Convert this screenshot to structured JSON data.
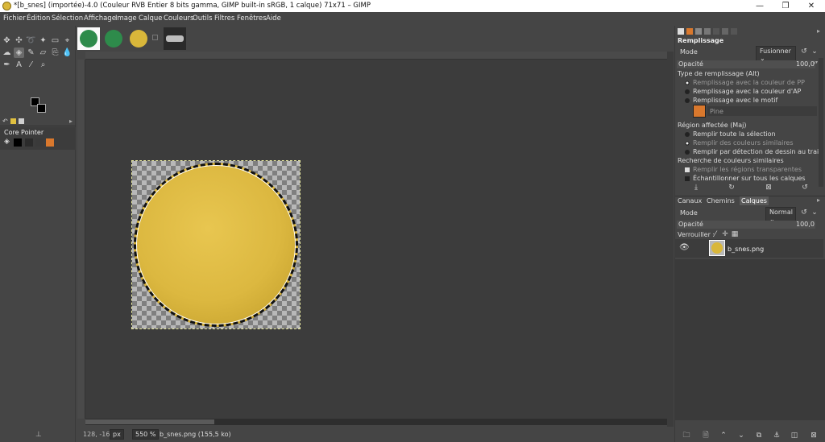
{
  "window": {
    "title": "*[b_snes] (importée)-4.0 (Couleur RVB Entier 8 bits gamma, GIMP built-in sRGB, 1 calque) 71x71 – GIMP",
    "minimize": "—",
    "maximize": "❐",
    "close": "✕"
  },
  "menu": [
    "Fichier",
    "Édition",
    "Sélection",
    "Affichage",
    "Image",
    "Calque",
    "Couleurs",
    "Outils",
    "Filtres",
    "Fenêtres",
    "Aide"
  ],
  "toolbox": {
    "device_panel_title": "Core Pointer",
    "device_swatch_colors": [
      "#000000",
      "#2b2b2b",
      "#3a3a3a",
      "#d9782d"
    ]
  },
  "image_tabs": [
    {
      "name": "green-button-1",
      "color": "#2e8b4b"
    },
    {
      "name": "green-button-2",
      "color": "#2e8b4b"
    },
    {
      "name": "yellow-button",
      "color": "#d9b73a"
    }
  ],
  "statusbar": {
    "coords": "128, -16",
    "unit": "px",
    "zoom": "550 %",
    "fileinfo": "b_snes.png (155,5 ko)"
  },
  "fill_options": {
    "title": "Remplissage",
    "mode_label": "Mode",
    "mode_value": "Fusionner",
    "opacity_label": "Opacité",
    "opacity_value": "100,0",
    "opacity_fraction": 1.0,
    "fill_type_label": "Type de remplissage  (Alt)",
    "fill_types": [
      {
        "label": "Remplissage avec la couleur de PP",
        "selected": true
      },
      {
        "label": "Remplissage avec la couleur d'AP",
        "selected": false
      },
      {
        "label": "Remplissage avec le motif",
        "selected": false
      }
    ],
    "pattern_name": "Pine",
    "region_label": "Région affectée  (Maj)",
    "regions": [
      {
        "label": "Remplir toute la sélection",
        "selected": false
      },
      {
        "label": "Remplir des couleurs similaires",
        "selected": true
      },
      {
        "label": "Remplir par détection de dessin au trait",
        "selected": false
      }
    ],
    "similar_label": "Recherche de couleurs similaires",
    "similar_options": [
      {
        "label": "Remplir les régions transparentes",
        "checked": true
      },
      {
        "label": "Échantillonner sur tous les calques",
        "checked": false
      }
    ]
  },
  "layers_panel": {
    "tabs": [
      "Canaux",
      "Chemins",
      "Calques"
    ],
    "mode_label": "Mode",
    "mode_value": "Normal",
    "opacity_label": "Opacité",
    "opacity_value": "100,0",
    "opacity_fraction": 1.0,
    "lock_label": "Verrouiller :",
    "layers": [
      {
        "name": "b_snes.png",
        "visible": true
      }
    ]
  },
  "colors": {
    "accent_orange": "#d9782d",
    "coin_yellow": "#d9b73a",
    "coin_green": "#2e8b4b"
  }
}
